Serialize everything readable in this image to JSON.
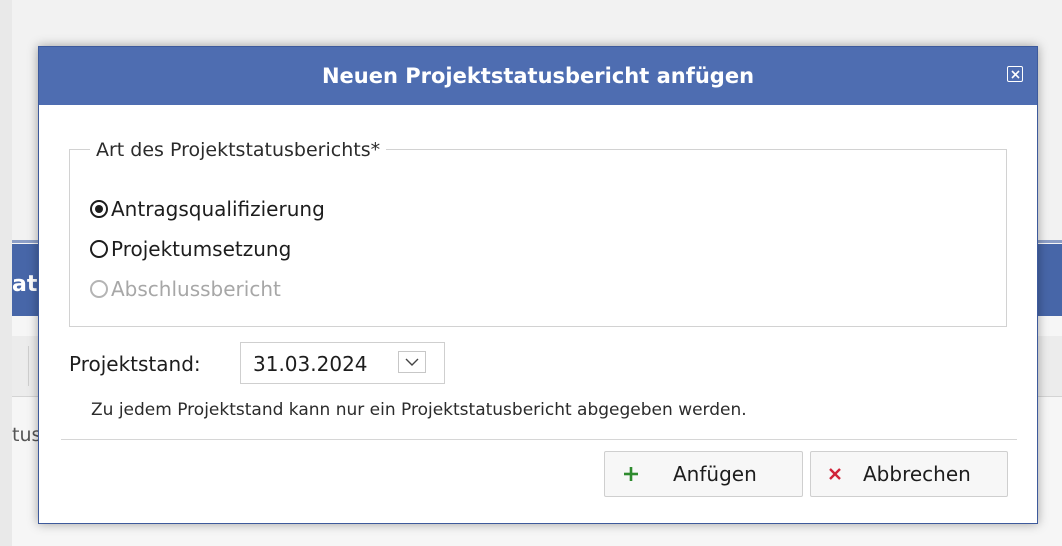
{
  "background": {
    "bar_text": "at",
    "status_fragment": "tus"
  },
  "dialog": {
    "title": "Neuen Projektstatusbericht anfügen",
    "report_type": {
      "legend": "Art des Projektstatusberichts*",
      "options": [
        {
          "label": "Antragsqualifizierung",
          "checked": true,
          "disabled": false
        },
        {
          "label": "Projektumsetzung",
          "checked": false,
          "disabled": false
        },
        {
          "label": "Abschlussbericht",
          "checked": false,
          "disabled": true
        }
      ]
    },
    "projektstand": {
      "label": "Projektstand:",
      "value": "31.03.2024"
    },
    "hint": "Zu jedem Projektstand kann nur ein Projektstatusbericht abgegeben werden.",
    "buttons": {
      "add_label": "Anfügen",
      "cancel_label": "Abbrechen"
    }
  },
  "colors": {
    "titlebar": "#4e6db1",
    "add_icon": "#2e8b2e",
    "cancel_icon": "#d0243a"
  }
}
